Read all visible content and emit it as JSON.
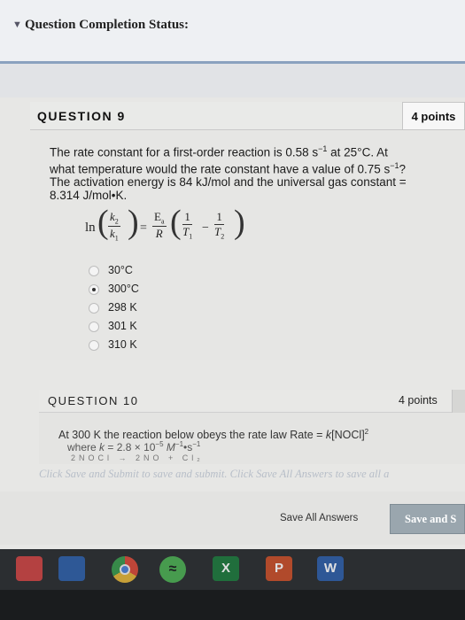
{
  "status": {
    "title": "Question Completion Status:"
  },
  "question9": {
    "title": "QUESTION 9",
    "points": "4 points",
    "text_line1_a": "The rate constant for a first-order reaction is 0.58 s",
    "text_line1_sup": "−1",
    "text_line1_b": " at 25°C. At",
    "text_line2_a": "what temperature would the rate constant have a value of 0.75 s",
    "text_line2_sup": "−1",
    "text_line2_b": "?",
    "text_line3": "The activation energy is 84 kJ/mol and the universal gas constant =",
    "text_line4": "8.314 J/mol•K.",
    "formula": {
      "ln": "ln",
      "k": "k",
      "sub2": "2",
      "sub1": "1",
      "minus": "=",
      "ea": "E",
      "ea_sub": "a",
      "r": "R",
      "one": "1",
      "t": "T",
      "op_minus": "−"
    },
    "answers": [
      {
        "label": "30°C",
        "selected": false
      },
      {
        "label": "300°C",
        "selected": true
      },
      {
        "label": "298 K",
        "selected": false
      },
      {
        "label": "301 K",
        "selected": false
      },
      {
        "label": "310 K",
        "selected": false
      }
    ]
  },
  "question10": {
    "title": "QUESTION 10",
    "points": "4 points",
    "text_a": "At 300 K the reaction below obeys the rate law Rate = ",
    "text_k": "k",
    "text_b": "[NOCl]",
    "text_sup": "2",
    "line2_a": "where ",
    "line2_k": "k",
    "line2_b": " = 2.8 × 10",
    "line2_sup1": "−5",
    "line2_c": " M",
    "line2_sup2": "−1",
    "line2_d": "•s",
    "line2_sup3": "−1",
    "line3": "2NOCl → 2NO + Cl₂"
  },
  "instruction": "Click Save and Submit to save and submit. Click Save All Answers to save all a",
  "footer": {
    "save_all": "Save All Answers",
    "save_submit": "Save and S"
  }
}
